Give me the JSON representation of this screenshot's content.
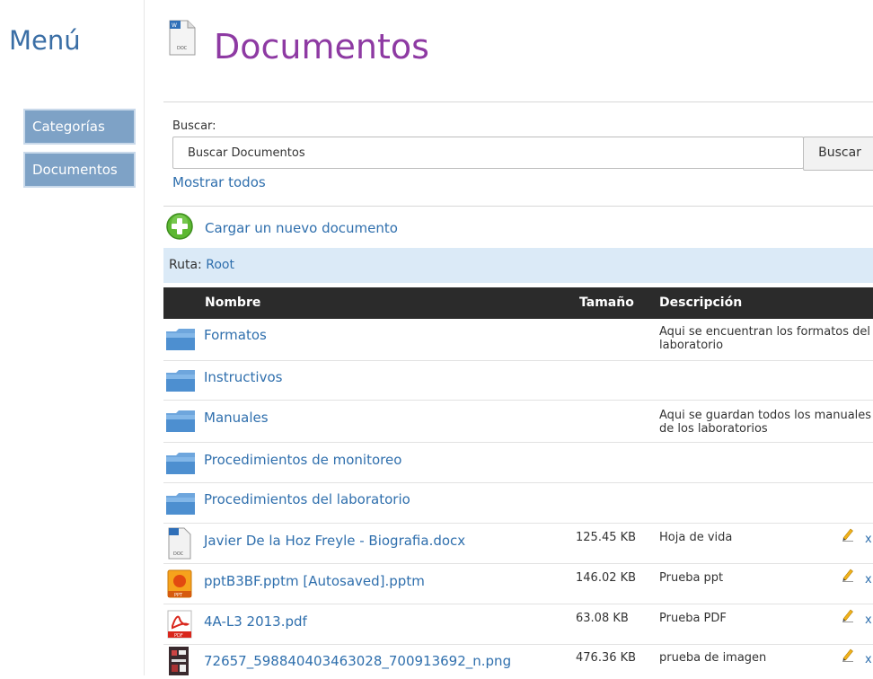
{
  "sidebar": {
    "title": "Menú",
    "items": [
      {
        "label": "Categorías"
      },
      {
        "label": "Documentos"
      }
    ]
  },
  "header": {
    "title": "Documentos"
  },
  "search": {
    "label": "Buscar:",
    "placeholder": "Buscar Documentos",
    "button_label": "Buscar",
    "show_all_label": "Mostrar todos"
  },
  "upload": {
    "label": "Cargar un nuevo documento"
  },
  "path": {
    "label": "Ruta:",
    "value": "Root"
  },
  "table": {
    "columns": {
      "name": "Nombre",
      "size": "Tamaño",
      "description": "Descripción"
    },
    "folders": [
      {
        "name": "Formatos",
        "description": "Aqui se encuentran los formatos del laboratorio"
      },
      {
        "name": "Instructivos",
        "description": ""
      },
      {
        "name": "Manuales",
        "description": "Aqui se guardan todos los manuales de los laboratorios"
      },
      {
        "name": "Procedimientos de monitoreo",
        "description": ""
      },
      {
        "name": "Procedimientos del laboratorio",
        "description": ""
      }
    ],
    "files": [
      {
        "name": "Javier De la Hoz Freyle - Biografia.docx",
        "size": "125.45 KB",
        "description": "Hoja de vida",
        "icon": "doc-file-icon",
        "delete_label": "x"
      },
      {
        "name": "pptB3BF.pptm [Autosaved].pptm",
        "size": "146.02 KB",
        "description": "Prueba ppt",
        "icon": "ppt-file-icon",
        "delete_label": "x"
      },
      {
        "name": "4A-L3 2013.pdf",
        "size": "63.08 KB",
        "description": "Prueba PDF",
        "icon": "pdf-file-icon",
        "delete_label": "x"
      },
      {
        "name": "72657_598840403463028_700913692_n.png",
        "size": "476.36 KB",
        "description": "prueba de imagen",
        "icon": "image-file-icon",
        "delete_label": "x"
      }
    ]
  },
  "colors": {
    "title": "#8e3aa3",
    "menu_title": "#3a6ea5",
    "link": "#2f6fad",
    "sidebar_button": "#7ea2c6",
    "path_bar": "#dbeaf7",
    "table_header": "#2b2b2b"
  }
}
